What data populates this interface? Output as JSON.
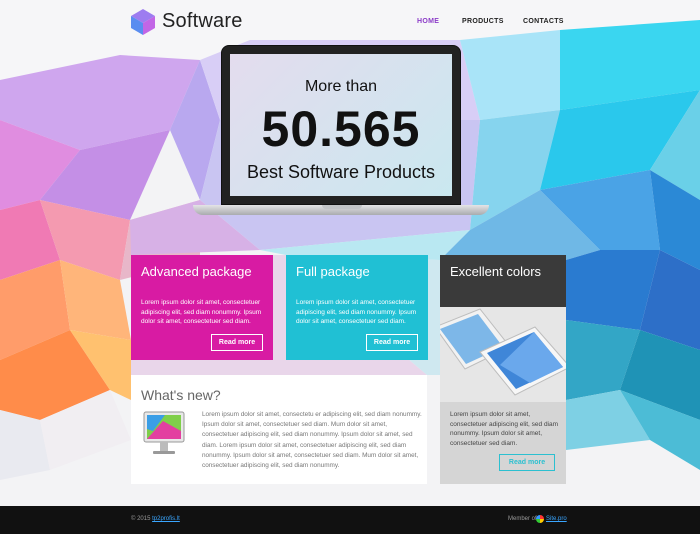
{
  "header": {
    "brand": "Software",
    "nav": [
      "HOME",
      "PRODUCTS",
      "CONTACTS"
    ],
    "active_nav": "HOME"
  },
  "hero": {
    "line1": "More than",
    "number": "50.565",
    "line2": "Best Software Products"
  },
  "cards": [
    {
      "title": "Advanced package",
      "text": "Lorem ipsum dolor sit amet, consectetuer adipiscing elit, sed diam nonummy. Ipsum dolor sit amet, consectetuer sed diam.",
      "button": "Read more",
      "color": "#d81ba3"
    },
    {
      "title": "Full package",
      "text": "Lorem ipsum dolor sit amet, consectetuer adipiscing elit, sed diam nonummy. Ipsum dolor sit amet, consectetuer sed diam.",
      "button": "Read more",
      "color": "#20c0d4"
    },
    {
      "title": "Excellent colors",
      "text": "Lorem ipsum dolor sit amet, consectetuer adipiscing elit, sed diam nonummy. Ipsum dolor sit amet, consectetuer sed diam.",
      "button": "Read more",
      "color": "#3a3a3a"
    }
  ],
  "news": {
    "title": "What's new?",
    "text": "Lorem ipsum dolor sit amet, consectetu er adipiscing elit, sed diam nonummy. Ipsum dolor sit amet, consectetuer sed diam. Mum dolor sit amet, consectetuer adipiscing elit, sed diam nonummy. Ipsum dolor sit amet, sed diam. Lorem ipsum dolor sit amet, consectetuer adipiscing elit, sed diam nonummy. Ipsum dolor sit amet, consectetuer sed diam. Mum dolor sit amet, consectetuer adipiscing elit, sed diam nonummy."
  },
  "footer": {
    "copyright_prefix": "© 2015 ",
    "copyright_link": "tp2profis.lt",
    "member_label": "Member of",
    "member_link": "Site.pro"
  }
}
